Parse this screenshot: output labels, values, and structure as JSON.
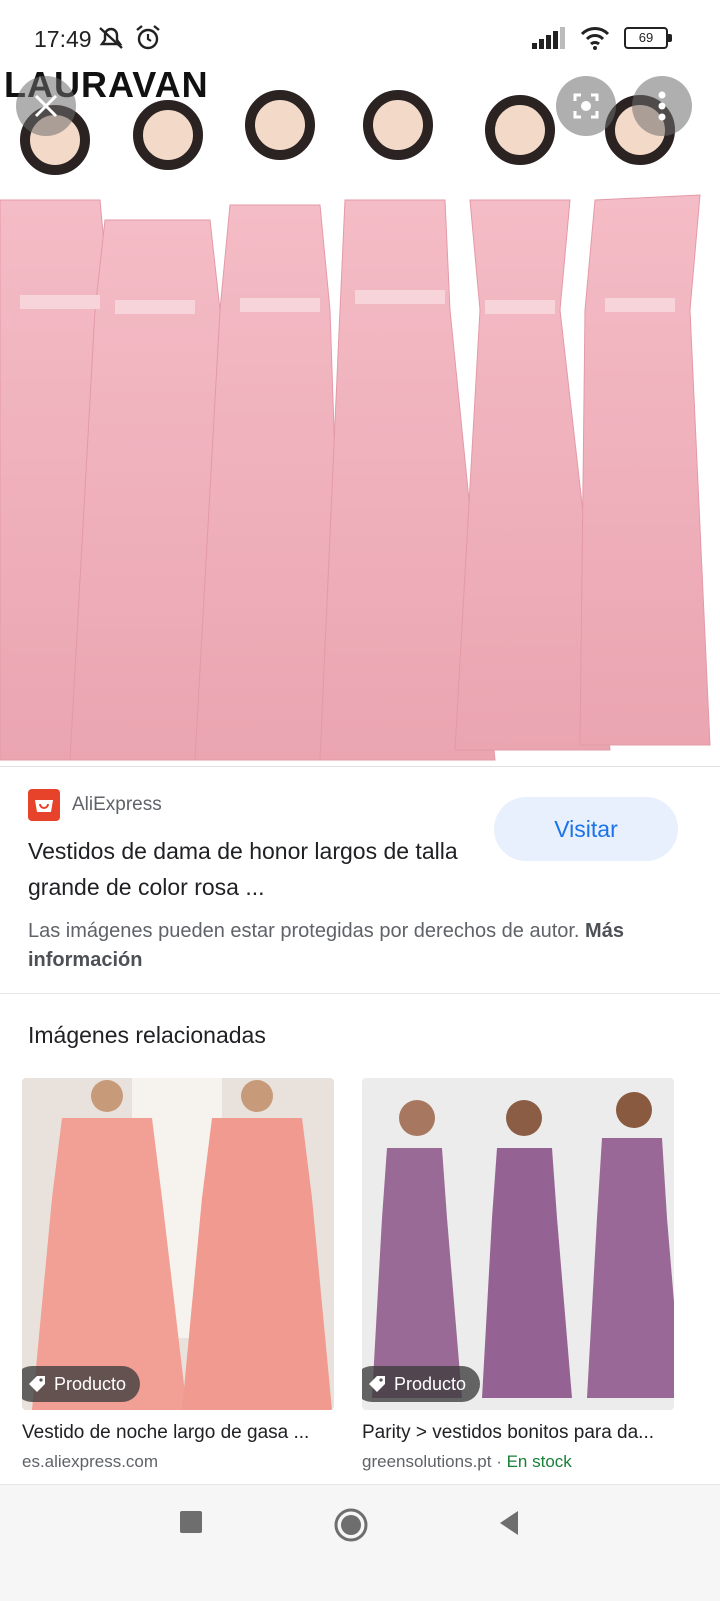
{
  "status_bar": {
    "time": "17:49",
    "battery": "69",
    "icons": [
      "mute-icon",
      "alarm-icon",
      "signal-icon",
      "wifi-icon",
      "battery-icon"
    ]
  },
  "hero": {
    "brand_text": "LAURAVAN",
    "dress_color": "#f0b3be"
  },
  "result": {
    "source": "AliExpress",
    "visit_label": "Visitar",
    "title": "Vestidos de dama de honor largos de talla grande de color rosa ...",
    "copyright": "Las imágenes pueden estar protegidas por derechos de autor.",
    "more_info": "Más información"
  },
  "related": {
    "heading": "Imágenes relacionadas",
    "items": [
      {
        "badge": "Producto",
        "title": "Vestido de noche largo de gasa ...",
        "source": "es.aliexpress.com",
        "stock": ""
      },
      {
        "badge": "Producto",
        "title": "Parity > vestidos bonitos para da...",
        "source": "greensolutions.pt · ",
        "stock": "En stock"
      }
    ]
  },
  "colors": {
    "accent": "#1a73e8",
    "visit_bg": "#e8f0fe",
    "stock_green": "#188038"
  }
}
